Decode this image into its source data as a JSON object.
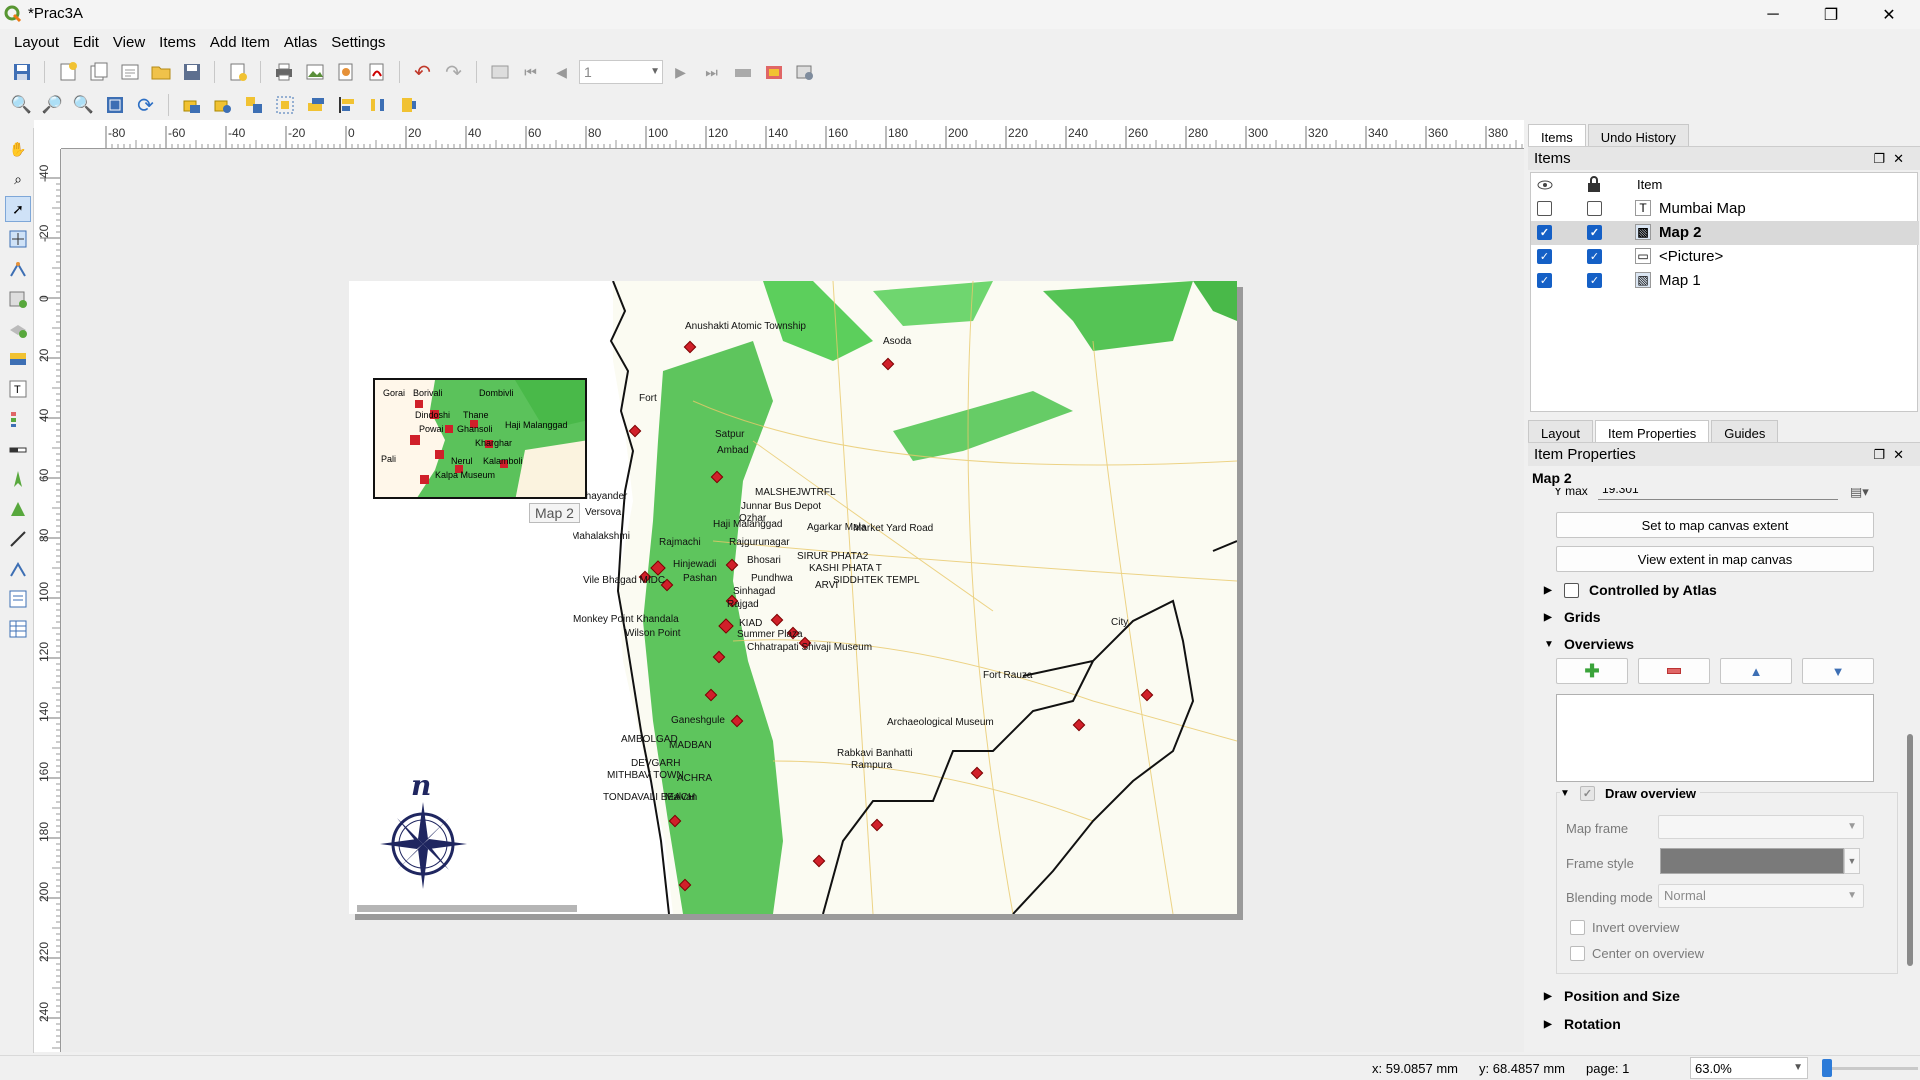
{
  "window": {
    "title": "*Prac3A"
  },
  "menu": [
    "Layout",
    "Edit",
    "View",
    "Items",
    "Add Item",
    "Atlas",
    "Settings"
  ],
  "toolbar": {
    "page_number": "1"
  },
  "ruler": {
    "h_ticks": [
      "-80",
      "-60",
      "-40",
      "-20",
      "0",
      "20",
      "40",
      "60",
      "80",
      "100",
      "120",
      "140",
      "160",
      "180",
      "200",
      "220",
      "240",
      "260",
      "280",
      "300",
      "320",
      "340",
      "360",
      "380"
    ],
    "v_ticks": [
      "-40",
      "-20",
      "0",
      "20",
      "40",
      "60",
      "80",
      "100",
      "120",
      "140",
      "160",
      "180",
      "200",
      "220",
      "240"
    ]
  },
  "map": {
    "inset_places": [
      "Gorai",
      "Borivali",
      "Dombivli",
      "Dindoshi",
      "Thane",
      "Powai",
      "Ghansoli",
      "Haji Malanggad",
      "Kharghar",
      "Kalamboli",
      "Kalpa Museum",
      "Nerul",
      "Pali"
    ],
    "places": [
      "Anushakti Atomic Township",
      "Asoda",
      "Fort",
      "Satpur",
      "Ambad",
      "MALSHEJWTRFL",
      "Bhayander",
      "Junnar Bus Depot",
      "Versova",
      "Ozhar",
      "Haji Malanggad",
      "Agarkar Mala",
      "Market Yard Road",
      "Mahalakshmi",
      "Rajmachi",
      "Rajgurunagar",
      "Bhosari",
      "Hinjewadi",
      "SIRUR PHATA2",
      "Vile Bhagad MIDC",
      "Pashan",
      "KASHI PHATA T",
      "Pundhwa",
      "SIDDHTEK TEMPL",
      "Sinhagad",
      "Rajgad",
      "Monkey Point Khandala",
      "Wilson Point",
      "Summer Plaza",
      "Chhatrapati Shivaji Museum",
      "City",
      "Fort Rauza",
      "Ganeshgule",
      "AMBOLGAD",
      "MADBAN",
      "Archaeological Museum",
      "DEVGARH",
      "MITHBAV TOWN",
      "ACHRA",
      "Rabkavi Banhatti",
      "Rampura",
      "TONDAVALI BEACH",
      "Malvan",
      "ARVI",
      "KIAD"
    ],
    "north_letter": "n",
    "map2_tooltip": "Map 2"
  },
  "right_panel": {
    "top_tabs": [
      "Items",
      "Undo History"
    ],
    "items_title": "Items",
    "items_column": "Item",
    "items": [
      {
        "name": "Mumbai Map",
        "visible": false,
        "locked": false,
        "selected": false,
        "icon": "text-icon"
      },
      {
        "name": "Map 2",
        "visible": true,
        "locked": true,
        "selected": true,
        "icon": "map-icon"
      },
      {
        "name": "<Picture>",
        "visible": true,
        "locked": true,
        "selected": false,
        "icon": "picture-icon"
      },
      {
        "name": "Map 1",
        "visible": true,
        "locked": true,
        "selected": false,
        "icon": "map-icon"
      }
    ],
    "bottom_tabs": [
      "Layout",
      "Item Properties",
      "Guides"
    ],
    "properties_title": "Item Properties",
    "item_name": "Map 2",
    "ymax_label": "Y max",
    "ymax_value": "19.301",
    "btn_canvas_extent": "Set to map canvas extent",
    "btn_view_extent": "View extent in map canvas",
    "controlled_by_atlas": "Controlled by Atlas",
    "grids": "Grids",
    "overviews": "Overviews",
    "draw_overview": "Draw overview",
    "map_frame_label": "Map frame",
    "frame_style_label": "Frame style",
    "blending_mode_label": "Blending mode",
    "blending_mode_value": "Normal",
    "invert_overview": "Invert overview",
    "center_on_overview": "Center on overview",
    "position_and_size": "Position and Size",
    "rotation": "Rotation"
  },
  "status": {
    "x": "x: 59.0857 mm",
    "y": "y: 68.4857 mm",
    "page": "page: 1",
    "zoom": "63.0%"
  }
}
